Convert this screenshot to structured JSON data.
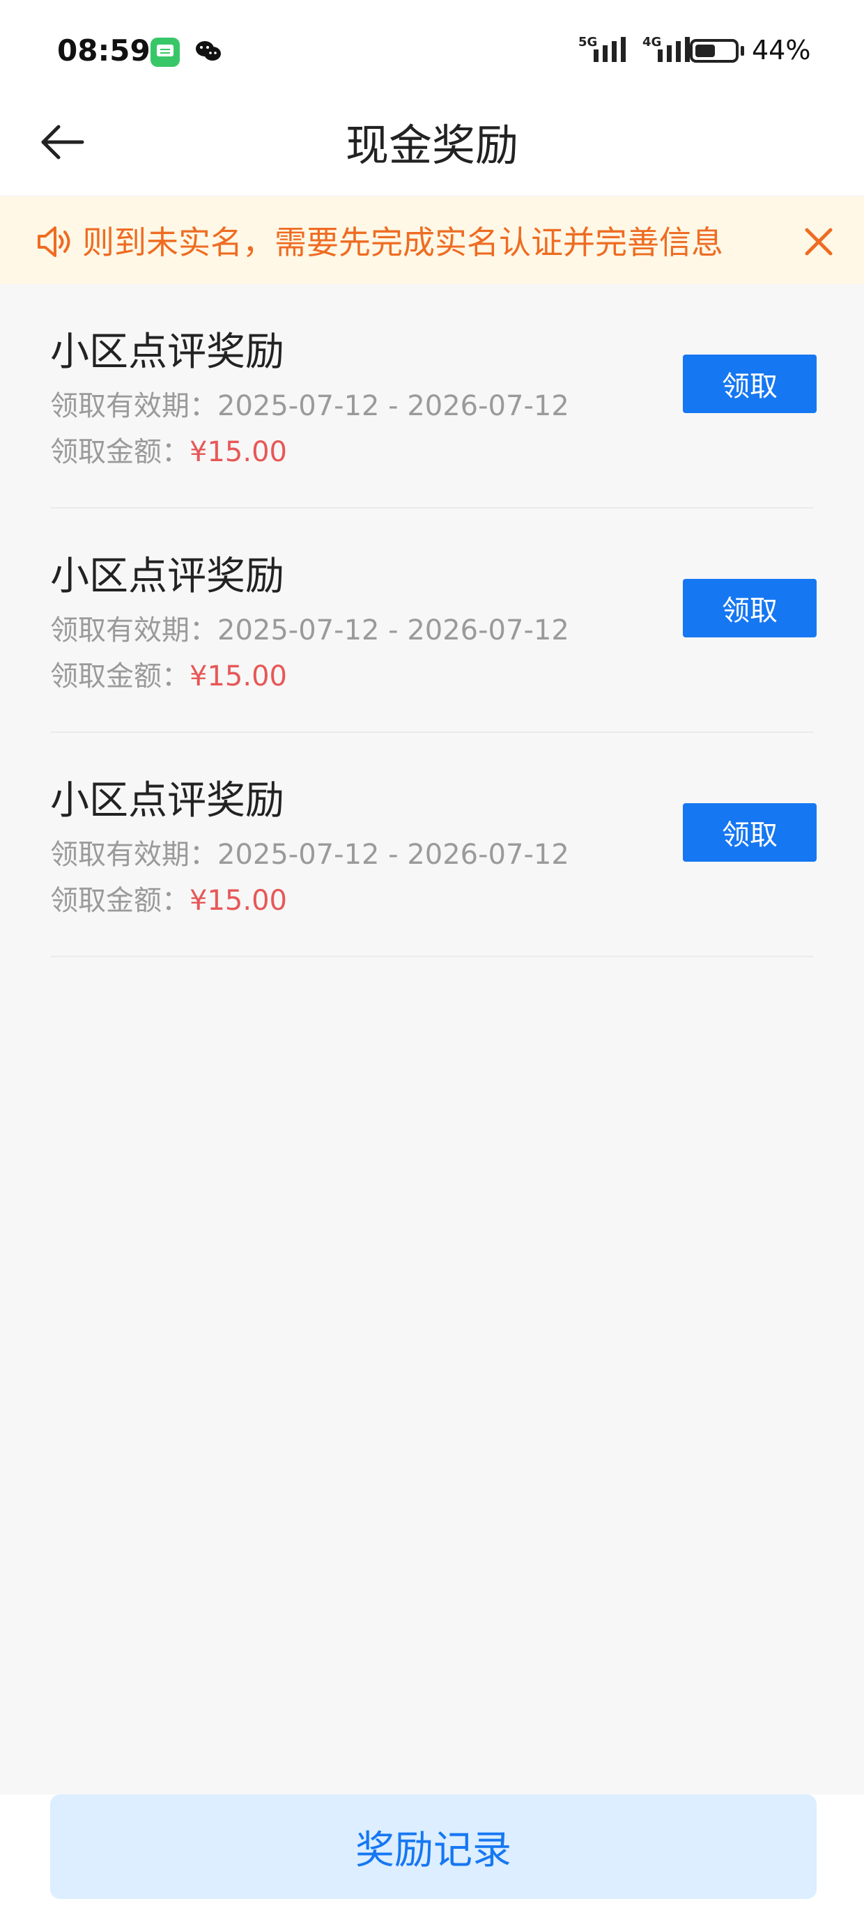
{
  "status_bar": {
    "time": "08:59",
    "network_1": "5G",
    "network_2": "4G",
    "battery": "44%"
  },
  "header": {
    "title": "现金奖励"
  },
  "notice": {
    "text": "则到未实名，需要先完成实名认证并完善信息",
    "icon": "speaker-icon",
    "close_icon": "close-icon"
  },
  "rewards": [
    {
      "title": "小区点评奖励",
      "period_label": "领取有效期：",
      "period": "2025-07-12 - 2026-07-12",
      "amount_label": "领取金额：",
      "amount": "¥15.00",
      "button": "领取"
    },
    {
      "title": "小区点评奖励",
      "period_label": "领取有效期：",
      "period": "2025-07-12 - 2026-07-12",
      "amount_label": "领取金额：",
      "amount": "¥15.00",
      "button": "领取"
    },
    {
      "title": "小区点评奖励",
      "period_label": "领取有效期：",
      "period": "2025-07-12 - 2026-07-12",
      "amount_label": "领取金额：",
      "amount": "¥15.00",
      "button": "领取"
    }
  ],
  "footer": {
    "record_button": "奖励记录"
  },
  "colors": {
    "accent": "#1677f2",
    "warning": "#ee6c22",
    "amount": "#e75757",
    "notice_bg": "#fff8e6"
  }
}
